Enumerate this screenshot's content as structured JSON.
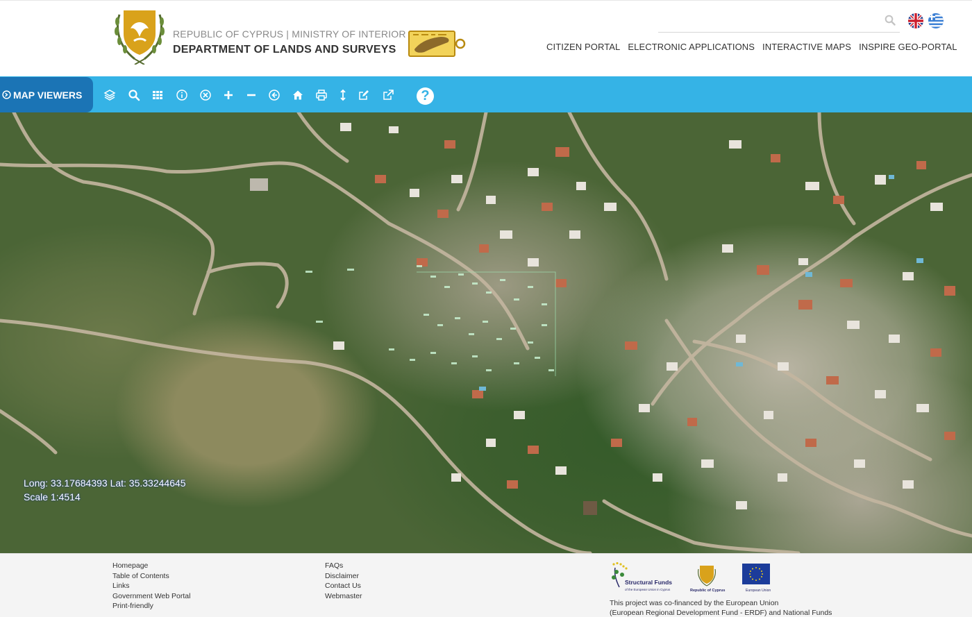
{
  "header": {
    "ministry": "REPUBLIC OF CYPRUS | MINISTRY OF INTERIOR",
    "department": "DEPARTMENT OF LANDS AND SURVEYS",
    "search": {
      "placeholder": "",
      "value": "",
      "icon": "search-icon"
    },
    "languages": [
      "English",
      "Ελληνικά"
    ],
    "nav": [
      "CITIZEN PORTAL",
      "ELECTRONIC APPLICATIONS",
      "INTERACTIVE MAPS",
      "INSPIRE GEO-PORTAL"
    ]
  },
  "toolbar": {
    "map_viewers_label": "MAP VIEWERS",
    "accent": "#35b3e6",
    "tab_color": "#1b74b5",
    "tools": [
      "layers-icon",
      "search-icon",
      "grid-icon",
      "info-icon",
      "clear-icon",
      "zoom-in-icon",
      "zoom-out-icon",
      "back-icon",
      "home-icon",
      "print-icon",
      "measure-icon",
      "edit-icon",
      "external-link-icon",
      "help-icon"
    ],
    "help_symbol": "?"
  },
  "map": {
    "coordinates": "Long: 33.17684393 Lat: 35.33244645",
    "scale": "Scale 1:4514"
  },
  "footer": {
    "col1": [
      "Homepage",
      "Table of Contents",
      "Links",
      "Government Web Portal",
      "Print-friendly"
    ],
    "col2": [
      "FAQs",
      "Disclaimer",
      "Contact Us",
      "Webmaster"
    ],
    "logos": {
      "structural_funds": "Structural Funds",
      "structural_funds_sub": "of the European Union in Cyprus",
      "republic": "Republic of Cyprus",
      "eu": "European Union"
    },
    "cofinance_line1": "This project was co-financed by the European Union",
    "cofinance_line2": "(European Regional Development Fund - ERDF) and National Funds"
  }
}
